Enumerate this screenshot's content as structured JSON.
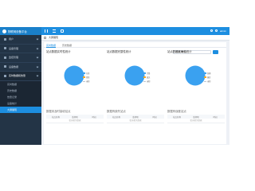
{
  "app": {
    "title": "物联网设备平台"
  },
  "header": {
    "user": "admin"
  },
  "sidebar": {
    "items": [
      {
        "label": "用户"
      },
      {
        "label": "设备管理"
      },
      {
        "label": "监控管理"
      },
      {
        "label": "设备数据"
      },
      {
        "label": "实时数据和告警"
      }
    ],
    "sub": [
      "实时数据",
      "历史数据",
      "告警记录",
      "设备统计",
      "大屏展现"
    ]
  },
  "tabbar": {
    "tab": "大屏展现"
  },
  "subtabs": [
    "实时数据",
    "历史数据"
  ],
  "date": {
    "value": "2021-08-16"
  },
  "cards": [
    {
      "title": "站点数据实时性统计",
      "legend": [
        "在线",
        "离线",
        "未知"
      ]
    },
    {
      "title": "站点数据完整性统计",
      "legend": [
        "完整",
        "缺失",
        "未知"
      ]
    },
    {
      "title": "站点数据准确性统计",
      "legend": [
        "准确",
        "偏差",
        "未知"
      ]
    }
  ],
  "tables": [
    {
      "title": "数据未及时接收站点",
      "cols": [
        "站点名称",
        "监测项",
        "时间"
      ],
      "empty": "暂无相关数据"
    },
    {
      "title": "数据有缺失站点",
      "cols": [
        "站点名称",
        "监测项",
        "时间"
      ],
      "empty": "暂无相关数据"
    },
    {
      "title": "数据有误差站点",
      "cols": [
        "站点名称",
        "监测项",
        "时间"
      ],
      "empty": "暂无相关数据"
    }
  ],
  "colors": {
    "primary": "#1d8ee0",
    "pie": "#3aa1f0",
    "sidebar": "#233446"
  }
}
